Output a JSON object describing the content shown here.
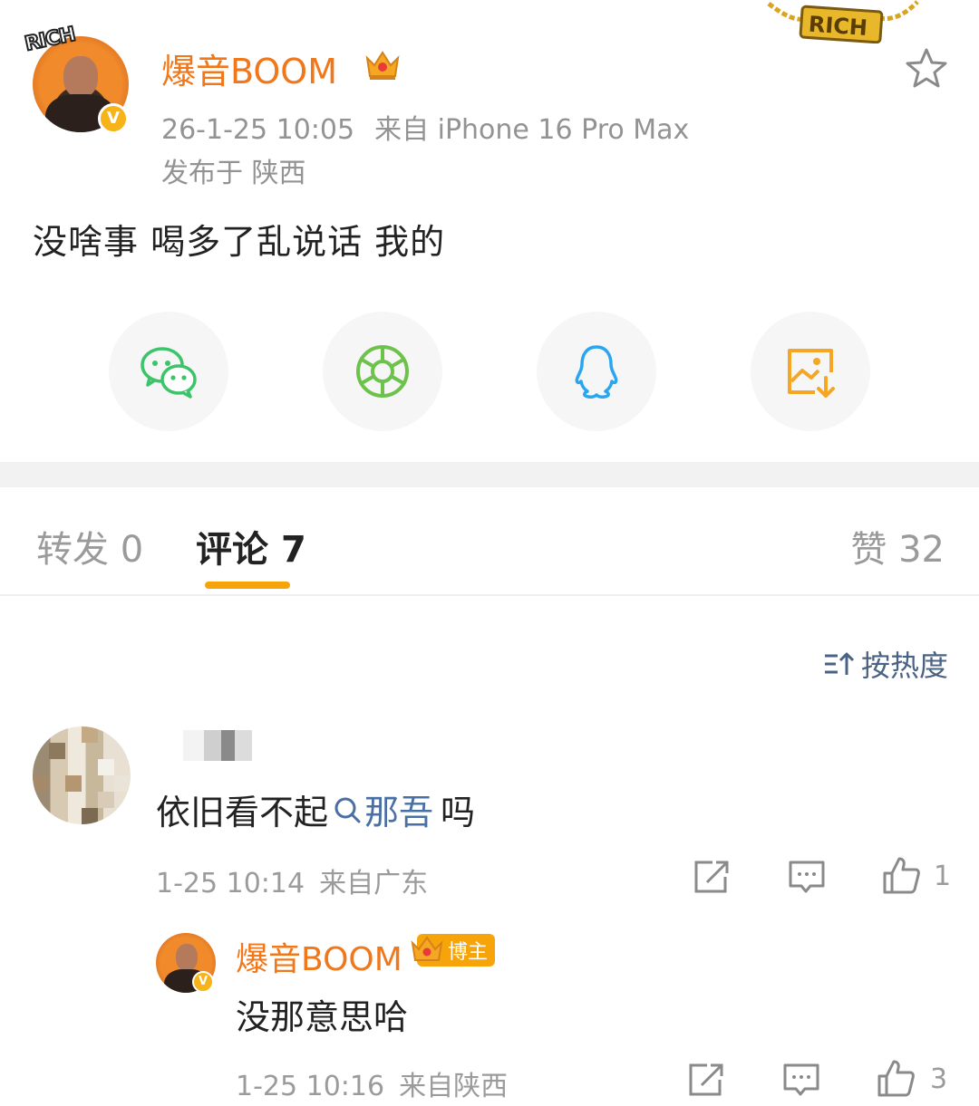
{
  "post": {
    "author_name": "爆音BOOM",
    "timestamp": "26-1-25 10:05",
    "source": "来自 iPhone 16 Pro Max",
    "location": "发布于 陕西",
    "text": "没啥事 喝多了乱说话 我的",
    "avatar_sticker": "RICH",
    "verified_mark": "V",
    "chain_text": "RICH"
  },
  "share": [
    {
      "name": "wechat",
      "icon": "wechat-icon",
      "color": "#3cc46a"
    },
    {
      "name": "moments",
      "icon": "moments-icon",
      "color": "#6cc24a"
    },
    {
      "name": "qq",
      "icon": "qq-icon",
      "color": "#2aa6f0"
    },
    {
      "name": "save-image",
      "icon": "save-image-icon",
      "color": "#f5a623"
    }
  ],
  "tabs": {
    "repost_label": "转发",
    "repost_count": "0",
    "comment_label": "评论",
    "comment_count": "7",
    "like_label": "赞",
    "like_count": "32"
  },
  "sort": {
    "label": "按热度"
  },
  "comments": [
    {
      "text_before": "依旧看不起",
      "search_link": "那吾",
      "text_after": " 吗",
      "time": "1-25 10:14",
      "source": "来自广东",
      "likes": "1",
      "reply": {
        "author_name": "爆音BOOM",
        "badge": "博主",
        "text": "没那意思哈",
        "time": "1-25 10:16",
        "source": "来自陕西",
        "likes": "3"
      }
    }
  ],
  "colors": {
    "accent_orange": "#f0771a",
    "tab_indicator": "#f7a40a",
    "link_blue": "#4a6fa5"
  }
}
